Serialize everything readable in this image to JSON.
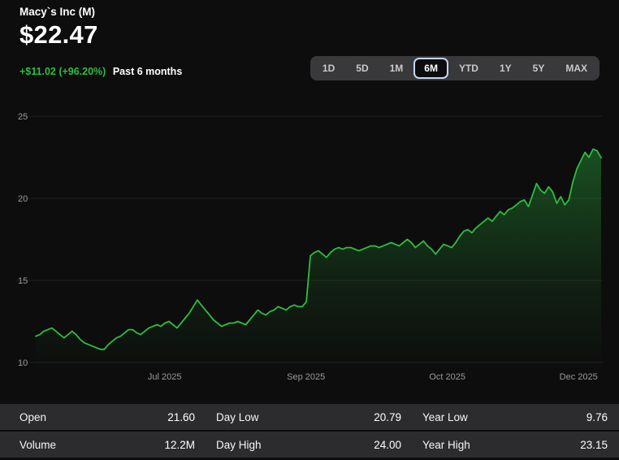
{
  "header": {
    "title": "Macy`s Inc (M)",
    "price": "$22.47",
    "change": "+$11.02 (+96.20%)",
    "change_period": "Past 6 months"
  },
  "ranges": {
    "options": [
      "1D",
      "5D",
      "1M",
      "6M",
      "YTD",
      "1Y",
      "5Y",
      "MAX"
    ],
    "selected": "6M"
  },
  "chart_data": {
    "type": "area",
    "title": "Macy`s Inc (M) price, past 6 months",
    "line_color": "#2ebd40",
    "grid": true,
    "ylim": [
      9.5,
      25.8
    ],
    "yticks": [
      25,
      20,
      15,
      10
    ],
    "xticks": [
      {
        "label": "Jul 2025",
        "f": 0.228
      },
      {
        "label": "Sep 2025",
        "f": 0.478
      },
      {
        "label": "Oct 2025",
        "f": 0.728
      },
      {
        "label": "Dec 2025",
        "f": 0.96
      }
    ],
    "values": [
      11.6,
      11.7,
      11.9,
      12.0,
      12.1,
      11.9,
      11.7,
      11.5,
      11.7,
      11.9,
      11.7,
      11.4,
      11.2,
      11.1,
      11.0,
      10.9,
      10.8,
      10.8,
      11.1,
      11.3,
      11.5,
      11.6,
      11.8,
      12.0,
      12.0,
      11.8,
      11.7,
      11.9,
      12.1,
      12.2,
      12.3,
      12.2,
      12.4,
      12.5,
      12.3,
      12.1,
      12.4,
      12.7,
      13.0,
      13.4,
      13.8,
      13.5,
      13.2,
      12.9,
      12.6,
      12.4,
      12.2,
      12.3,
      12.4,
      12.4,
      12.5,
      12.4,
      12.3,
      12.6,
      12.9,
      13.2,
      13.0,
      12.9,
      13.1,
      13.2,
      13.4,
      13.3,
      13.2,
      13.4,
      13.5,
      13.4,
      13.4,
      13.7,
      16.5,
      16.7,
      16.8,
      16.6,
      16.4,
      16.7,
      16.9,
      17.0,
      16.9,
      17.0,
      17.0,
      16.9,
      16.8,
      16.9,
      17.0,
      17.1,
      17.1,
      17.0,
      17.1,
      17.2,
      17.3,
      17.2,
      17.1,
      17.3,
      17.5,
      17.3,
      17.0,
      17.2,
      17.4,
      17.1,
      16.9,
      16.6,
      16.9,
      17.2,
      17.1,
      17.0,
      17.3,
      17.7,
      18.0,
      18.1,
      17.9,
      18.2,
      18.4,
      18.6,
      18.8,
      18.6,
      18.9,
      19.2,
      19.0,
      19.3,
      19.4,
      19.6,
      19.8,
      19.9,
      19.5,
      20.2,
      20.9,
      20.5,
      20.3,
      20.7,
      20.4,
      19.7,
      20.1,
      19.6,
      19.9,
      21.0,
      21.8,
      22.3,
      22.8,
      22.5,
      23.0,
      22.9,
      22.47
    ]
  },
  "stats": {
    "rows": [
      [
        {
          "label": "Open",
          "value": "21.60"
        },
        {
          "label": "Day Low",
          "value": "20.79"
        },
        {
          "label": "Year Low",
          "value": "9.76"
        }
      ],
      [
        {
          "label": "Volume",
          "value": "12.2M"
        },
        {
          "label": "Day High",
          "value": "24.00"
        },
        {
          "label": "Year High",
          "value": "23.15"
        }
      ]
    ]
  },
  "colors": {
    "accent_green": "#2ebd40",
    "background": "#0d0d0d",
    "row_background": "#2c2c2e",
    "range_bar_background": "#39393b",
    "selected_ring": "#c3d7f3"
  }
}
